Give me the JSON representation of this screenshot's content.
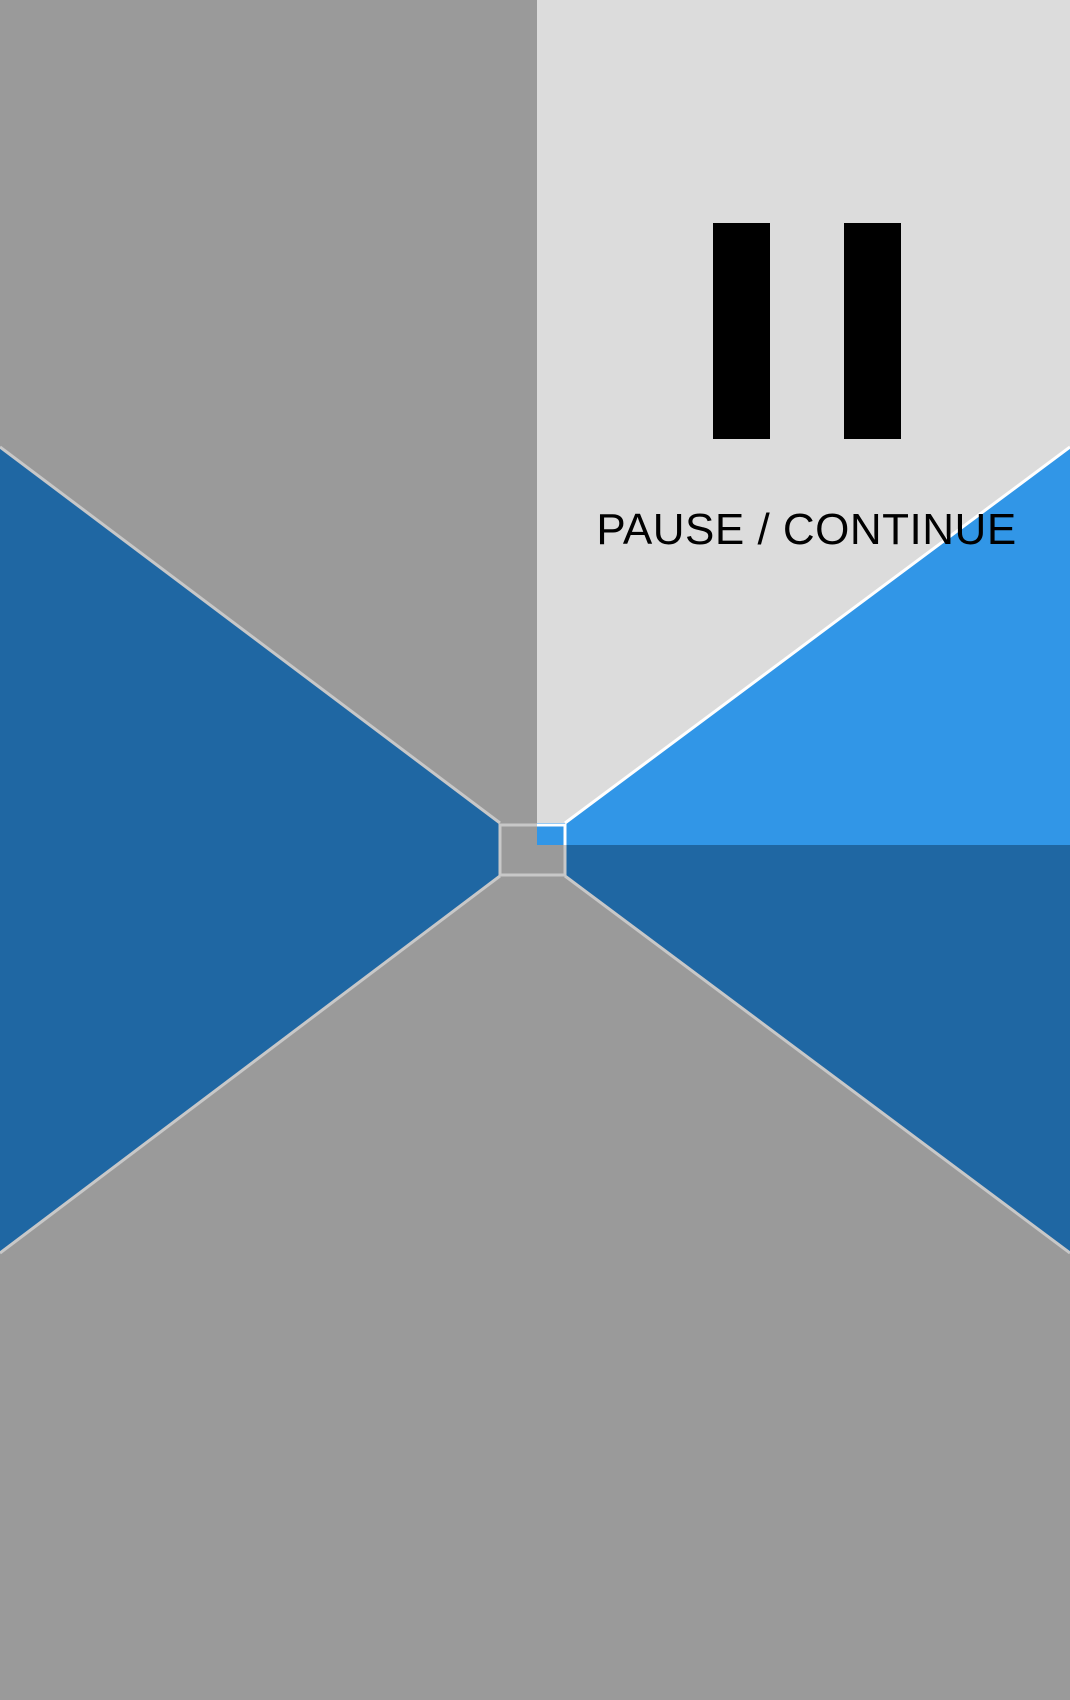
{
  "game": {
    "view": "tunnel-perspective",
    "pause_button": {
      "icon": "pause-icon",
      "label": "PAUSE / CONTINUE",
      "state": "highlighted"
    },
    "colors": {
      "wall_gray": "#9a9a9a",
      "wall_blue": "#1f67a3",
      "highlight_panel": "#dcdcdc",
      "highlight_blue": "#3196e7",
      "edge_line": "#c8c8c8",
      "icon": "#000000"
    }
  }
}
